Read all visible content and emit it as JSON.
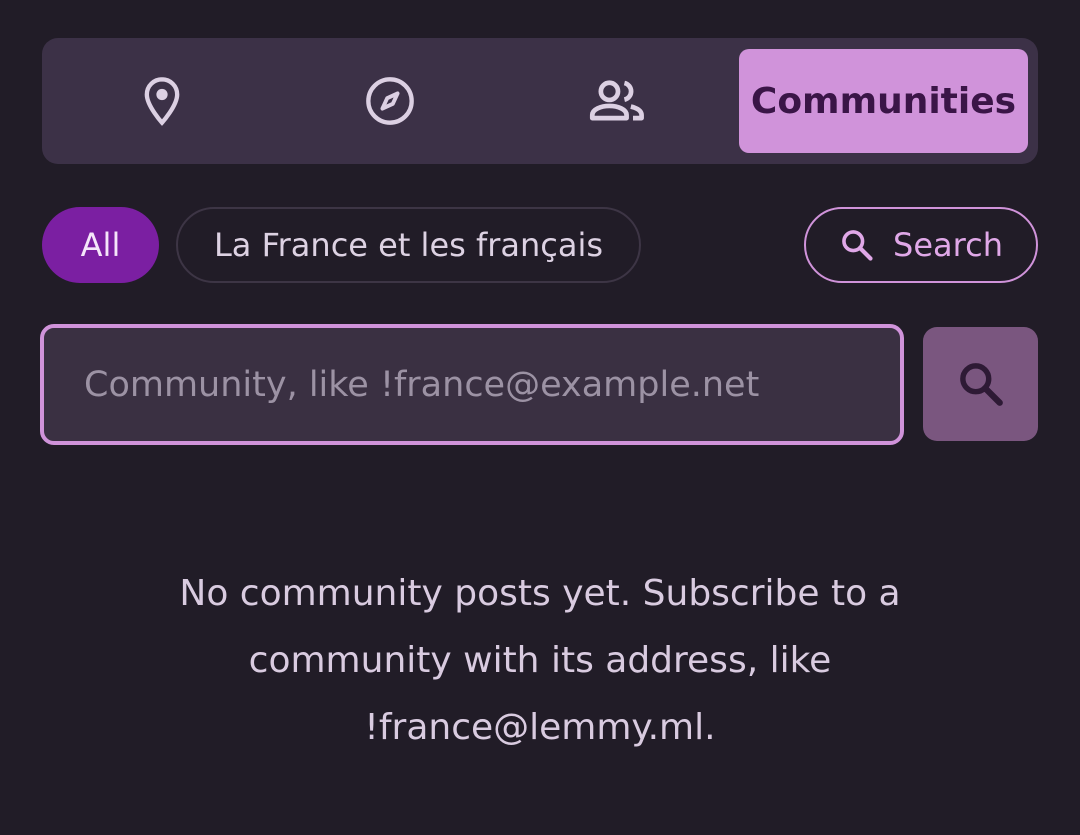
{
  "tabs": [
    {
      "icon": "location-pin-icon",
      "label": ""
    },
    {
      "icon": "compass-icon",
      "label": ""
    },
    {
      "icon": "people-icon",
      "label": ""
    },
    {
      "icon": "",
      "label": "Communities",
      "selected": true
    }
  ],
  "chips": {
    "all_label": "All",
    "france_label": "La France et les français",
    "search_label": "Search"
  },
  "search_input": {
    "value": "",
    "placeholder": "Community, like !france@example.net"
  },
  "empty_message": "No community posts yet. Subscribe to a community with its address, like !france@lemmy.ml.",
  "colors": {
    "background": "#211c27",
    "tabbar": "#3c3147",
    "accent": "#d093da",
    "chip_all": "#7b1fa2",
    "search_button": "#7a567f"
  }
}
